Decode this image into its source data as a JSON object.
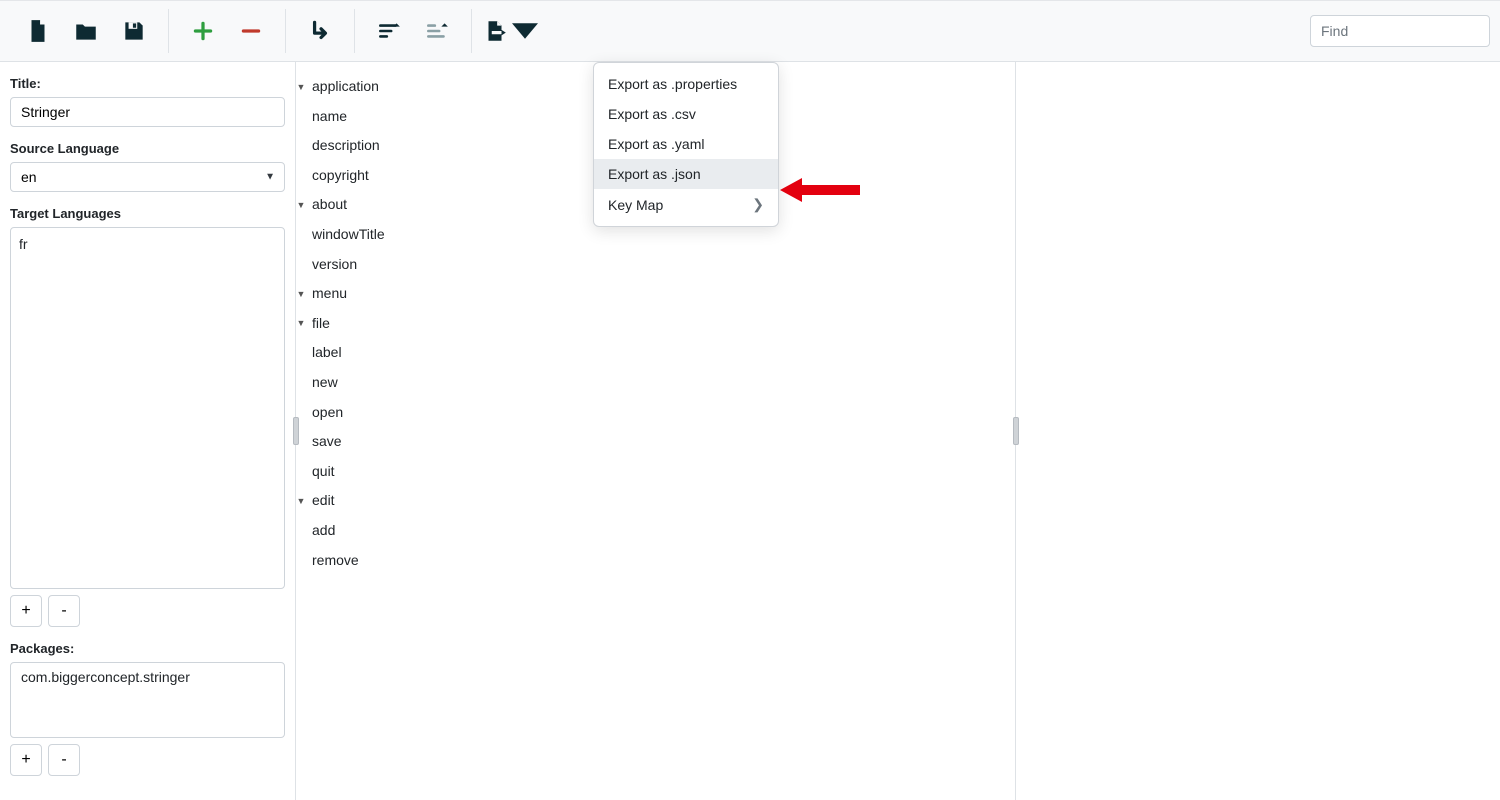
{
  "toolbar": {
    "find_placeholder": "Find"
  },
  "dropdown": {
    "items": {
      "properties": "Export as .properties",
      "csv": "Export as .csv",
      "yaml": "Export as .yaml",
      "json": "Export as .json",
      "keymap": "Key Map"
    }
  },
  "left": {
    "title_label": "Title:",
    "title_value": "Stringer",
    "source_lang_label": "Source Language",
    "source_lang_value": "en",
    "target_lang_label": "Target Languages",
    "target_lang_items": [
      "fr"
    ],
    "packages_label": "Packages:",
    "packages_value": "com.biggerconcept.stringer",
    "plus": "+",
    "minus": "-"
  },
  "tree": {
    "application": "application",
    "name": "name",
    "description": "description",
    "copyright": "copyright",
    "about": "about",
    "windowTitle": "windowTitle",
    "version": "version",
    "menu": "menu",
    "file": "file",
    "label": "label",
    "new": "new",
    "open": "open",
    "save": "save",
    "quit": "quit",
    "edit": "edit",
    "add": "add",
    "remove": "remove"
  }
}
